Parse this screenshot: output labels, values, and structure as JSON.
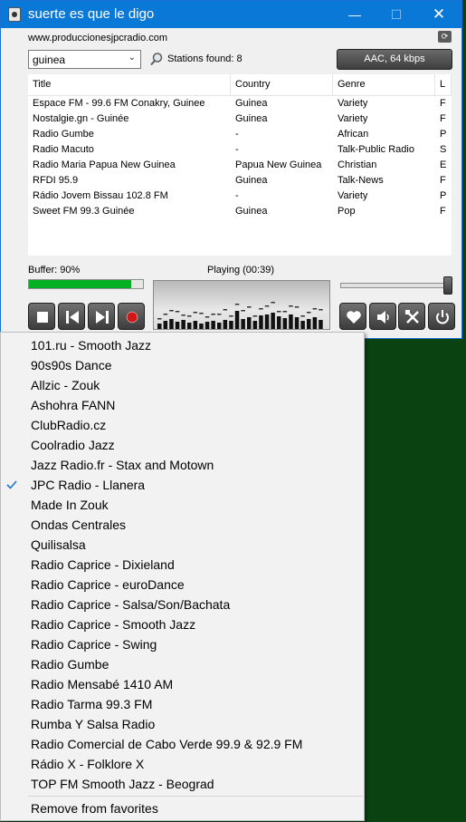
{
  "window": {
    "title": "suerte es que le digo",
    "minimize": "—",
    "maximize": "☐",
    "close": "✕"
  },
  "header": {
    "url": "www.produccionesjpcradio.com",
    "filter_value": "guinea",
    "stations_found": "Stations found: 8",
    "format_button": "AAC, 64 kbps"
  },
  "table": {
    "columns": [
      "Title",
      "Country",
      "Genre",
      "L"
    ],
    "rows": [
      [
        "Espace FM - 99.6 FM Conakry, Guinee",
        "Guinea",
        "Variety",
        "F"
      ],
      [
        "Nostalgie.gn - Guinée",
        "Guinea",
        "Variety",
        "F"
      ],
      [
        "Radio Gumbe",
        "-",
        "African",
        "P"
      ],
      [
        "Radio Macuto",
        "-",
        "Talk-Public Radio",
        "S"
      ],
      [
        "Radio Maria Papua New Guinea",
        "Papua New Guinea",
        "Christian",
        "E"
      ],
      [
        "RFDI 95.9",
        "Guinea",
        "Talk-News",
        "F"
      ],
      [
        "Rádio Jovem Bissau 102.8 FM",
        "-",
        "Variety",
        "P"
      ],
      [
        "Sweet FM 99.3 Guinée",
        "Guinea",
        "Pop",
        "F"
      ]
    ]
  },
  "player": {
    "buffer_label": "Buffer: 90%",
    "buffer_percent": 90,
    "status": "Playing (00:39)",
    "volume_percent": 100
  },
  "menu": {
    "items": [
      "101.ru - Smooth Jazz",
      "90s90s Dance",
      "Allzic - Zouk",
      "Ashohra FANN",
      "ClubRadio.cz",
      "Coolradio Jazz",
      "Jazz Radio.fr - Stax and Motown",
      "JPC Radio - Llanera",
      "Made In Zouk",
      "Ondas Centrales",
      "Quilisalsa",
      "Radio Caprice - Dixieland",
      "Radio Caprice - euroDance",
      "Radio Caprice - Salsa/Son/Bachata",
      "Radio Caprice - Smooth Jazz",
      "Radio Caprice - Swing",
      "Radio Gumbe",
      "Radio Mensabé 1410 AM",
      "Radio Tarma 99.3 FM",
      "Rumba Y Salsa Radio",
      "Radio Comercial de Cabo Verde 99.9 & 92.9 FM",
      "Rádio X - Folklore X",
      "TOP FM Smooth Jazz - Beograd"
    ],
    "checked_index": 7,
    "remove_label": "Remove from favorites"
  },
  "colors": {
    "titlebar": "#0a78d7",
    "desktop": "#0a4212",
    "buffer": "#06b025",
    "menu_check": "#1a73d4"
  },
  "icons": [
    "app-icon",
    "refresh-icon",
    "search-icon",
    "stop-icon",
    "previous-icon",
    "next-icon",
    "record-icon",
    "heart-icon",
    "speaker-icon",
    "tools-icon",
    "power-icon",
    "checkmark-icon"
  ]
}
